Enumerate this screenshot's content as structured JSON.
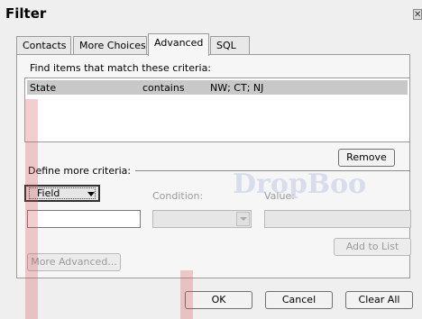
{
  "window": {
    "title": "Filter"
  },
  "tabs": [
    {
      "label": "Contacts"
    },
    {
      "label": "More Choices"
    },
    {
      "label": "Advanced"
    },
    {
      "label": "SQL"
    }
  ],
  "criteria": {
    "heading": "Find items that match these criteria:",
    "rows": [
      {
        "field": "State",
        "condition": "contains",
        "value": "NW; CT; NJ"
      }
    ],
    "remove_label": "Remove"
  },
  "define": {
    "heading": "Define more criteria:",
    "field_button": "Field",
    "condition_label": "Condition:",
    "value_label": "Value:",
    "add_label": "Add to List",
    "more_advanced_label": "More Advanced..."
  },
  "footer": {
    "ok_label": "OK",
    "cancel_label": "Cancel",
    "clear_label": "Clear All"
  },
  "watermark": {
    "text": "DropBoo"
  }
}
